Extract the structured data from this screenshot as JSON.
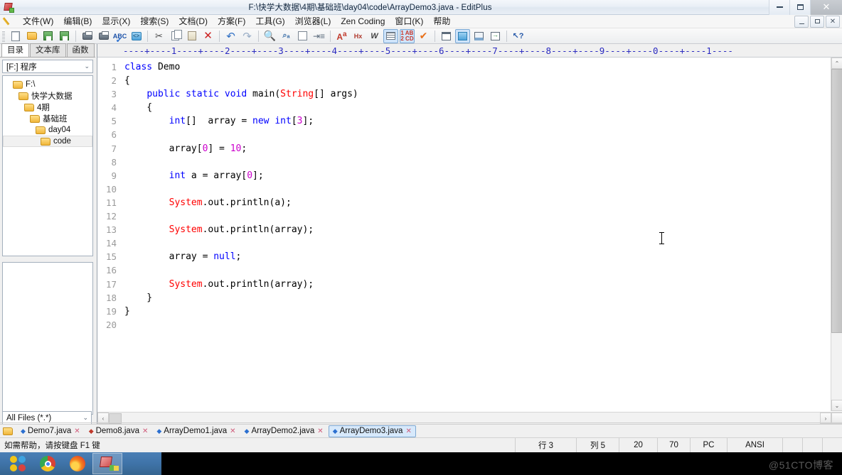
{
  "window": {
    "title": "F:\\快学大数据\\4期\\基础班\\day04\\code\\ArrayDemo3.java - EditPlus",
    "app_icon": "editplus-icon",
    "minimize": "–",
    "maximize": "❐",
    "close": "✕",
    "child_minimize": "–",
    "child_restore": "❐",
    "child_close": "✕"
  },
  "menu": {
    "pencil_icon": "pencil-icon",
    "items": [
      {
        "label": "文件(W)"
      },
      {
        "label": "编辑(B)"
      },
      {
        "label": "显示(X)"
      },
      {
        "label": "搜索(S)"
      },
      {
        "label": "文档(D)"
      },
      {
        "label": "方案(F)"
      },
      {
        "label": "工具(G)"
      },
      {
        "label": "浏览器(L)"
      },
      {
        "label": "Zen Coding"
      },
      {
        "label": "窗口(K)"
      },
      {
        "label": "帮助"
      }
    ]
  },
  "toolbar": {
    "buttons": [
      {
        "name": "new-file-icon"
      },
      {
        "name": "open-file-icon"
      },
      {
        "name": "save-icon"
      },
      {
        "name": "save-all-icon"
      },
      {
        "name": "print-preview-icon"
      },
      {
        "name": "print-icon"
      },
      {
        "name": "spellcheck-icon"
      },
      {
        "name": "html-tag-icon"
      },
      {
        "name": "cut-icon"
      },
      {
        "name": "copy-icon"
      },
      {
        "name": "paste-icon"
      },
      {
        "name": "delete-icon"
      },
      {
        "name": "undo-icon"
      },
      {
        "name": "redo-icon"
      },
      {
        "name": "find-icon"
      },
      {
        "name": "replace-icon"
      },
      {
        "name": "find-in-files-icon"
      },
      {
        "name": "goto-line-icon"
      },
      {
        "name": "font-size-icon"
      },
      {
        "name": "hex-view-icon"
      },
      {
        "name": "word-wrap-icon"
      },
      {
        "name": "indent-guide-icon"
      },
      {
        "name": "line-numbers-icon"
      },
      {
        "name": "compile-icon"
      },
      {
        "name": "toggle-output-icon"
      },
      {
        "name": "toggle-directory-icon"
      },
      {
        "name": "toggle-preview-icon"
      },
      {
        "name": "browser-preview-icon"
      },
      {
        "name": "context-help-icon"
      }
    ]
  },
  "sidebar": {
    "tabs": [
      {
        "label": "目录",
        "active": true
      },
      {
        "label": "文本库",
        "active": false
      },
      {
        "label": "函数",
        "active": false
      }
    ],
    "drive_select": "[F:] 程序",
    "dropdown_arrow": "⌄",
    "tree": [
      {
        "label": "F:\\",
        "depth": 0,
        "selected": false
      },
      {
        "label": "快学大数据",
        "depth": 1,
        "selected": false
      },
      {
        "label": "4期",
        "depth": 2,
        "selected": false
      },
      {
        "label": "基础班",
        "depth": 3,
        "selected": false
      },
      {
        "label": "day04",
        "depth": 4,
        "selected": false
      },
      {
        "label": "code",
        "depth": 5,
        "selected": true
      }
    ],
    "file_filter": "All Files (*.*)"
  },
  "editor": {
    "ruler": "----+----1----+----2----+----3----+----4----+----5----+----6----+----7----+----8----+----9----+----0----+----1----",
    "line_numbers": [
      "1",
      "2",
      "3",
      "4",
      "5",
      "6",
      "7",
      "8",
      "9",
      "10",
      "11",
      "12",
      "13",
      "14",
      "15",
      "16",
      "17",
      "18",
      "19",
      "20"
    ],
    "code_lines": [
      [
        {
          "t": "class ",
          "c": "k"
        },
        {
          "t": "Demo",
          "c": "p"
        }
      ],
      [
        {
          "t": "{",
          "c": "p"
        }
      ],
      [
        {
          "t": "    ",
          "c": "p"
        },
        {
          "t": "public static void ",
          "c": "k"
        },
        {
          "t": "main(",
          "c": "p"
        },
        {
          "t": "String",
          "c": "t"
        },
        {
          "t": "[] args)",
          "c": "p"
        }
      ],
      [
        {
          "t": "    {",
          "c": "p"
        }
      ],
      [
        {
          "t": "        ",
          "c": "p"
        },
        {
          "t": "int",
          "c": "k"
        },
        {
          "t": "[]  array = ",
          "c": "p"
        },
        {
          "t": "new int",
          "c": "k"
        },
        {
          "t": "[",
          "c": "p"
        },
        {
          "t": "3",
          "c": "n"
        },
        {
          "t": "];",
          "c": "p"
        }
      ],
      [
        {
          "t": "",
          "c": "p"
        }
      ],
      [
        {
          "t": "        array[",
          "c": "p"
        },
        {
          "t": "0",
          "c": "n"
        },
        {
          "t": "] = ",
          "c": "p"
        },
        {
          "t": "10",
          "c": "n"
        },
        {
          "t": ";",
          "c": "p"
        }
      ],
      [
        {
          "t": "",
          "c": "p"
        }
      ],
      [
        {
          "t": "        ",
          "c": "p"
        },
        {
          "t": "int",
          "c": "k"
        },
        {
          "t": " a = array[",
          "c": "p"
        },
        {
          "t": "0",
          "c": "n"
        },
        {
          "t": "];",
          "c": "p"
        }
      ],
      [
        {
          "t": "",
          "c": "p"
        }
      ],
      [
        {
          "t": "        ",
          "c": "p"
        },
        {
          "t": "System",
          "c": "t"
        },
        {
          "t": ".out.println(a);",
          "c": "p"
        }
      ],
      [
        {
          "t": "",
          "c": "p"
        }
      ],
      [
        {
          "t": "        ",
          "c": "p"
        },
        {
          "t": "System",
          "c": "t"
        },
        {
          "t": ".out.println(array);",
          "c": "p"
        }
      ],
      [
        {
          "t": "",
          "c": "p"
        }
      ],
      [
        {
          "t": "        array = ",
          "c": "p"
        },
        {
          "t": "null",
          "c": "k"
        },
        {
          "t": ";",
          "c": "p"
        }
      ],
      [
        {
          "t": "",
          "c": "p"
        }
      ],
      [
        {
          "t": "        ",
          "c": "p"
        },
        {
          "t": "System",
          "c": "t"
        },
        {
          "t": ".out.println(array);",
          "c": "p"
        }
      ],
      [
        {
          "t": "    }",
          "c": "p"
        }
      ],
      [
        {
          "t": "}",
          "c": "p"
        }
      ],
      [
        {
          "t": "",
          "c": "p"
        }
      ]
    ],
    "colors": {
      "keyword": "#0000ff",
      "type": "#ff0000",
      "number": "#cc00cc",
      "plain": "#000000",
      "ruler": "#2b2bc0",
      "gutter": "#9a9a9a",
      "background": "#ffffff"
    },
    "scroll_up": "⌃",
    "scroll_down": "⌄",
    "scroll_left": "‹",
    "scroll_right": "›"
  },
  "tabs": {
    "folder_icon": "folder-icon",
    "items": [
      {
        "label": "Demo7.java",
        "active": false,
        "dot": "blue"
      },
      {
        "label": "Demo8.java",
        "active": false,
        "dot": "red"
      },
      {
        "label": "ArrayDemo1.java",
        "active": false,
        "dot": "blue"
      },
      {
        "label": "ArrayDemo2.java",
        "active": false,
        "dot": "blue"
      },
      {
        "label": "ArrayDemo3.java",
        "active": true,
        "dot": "blue"
      }
    ],
    "close_glyph": "✕"
  },
  "statusbar": {
    "hint": "如需帮助，请按键盘 F1 键",
    "line": "行 3",
    "column": "列 5",
    "value1": "20",
    "value2": "70",
    "platform": "PC",
    "encoding": "ANSI"
  },
  "taskbar": {
    "items": [
      {
        "name": "start-orb-icon",
        "active": false
      },
      {
        "name": "chrome-icon",
        "active": false
      },
      {
        "name": "firefox-icon",
        "active": false
      },
      {
        "name": "editplus-icon",
        "active": true
      }
    ],
    "watermark": "@51CTO博客"
  }
}
